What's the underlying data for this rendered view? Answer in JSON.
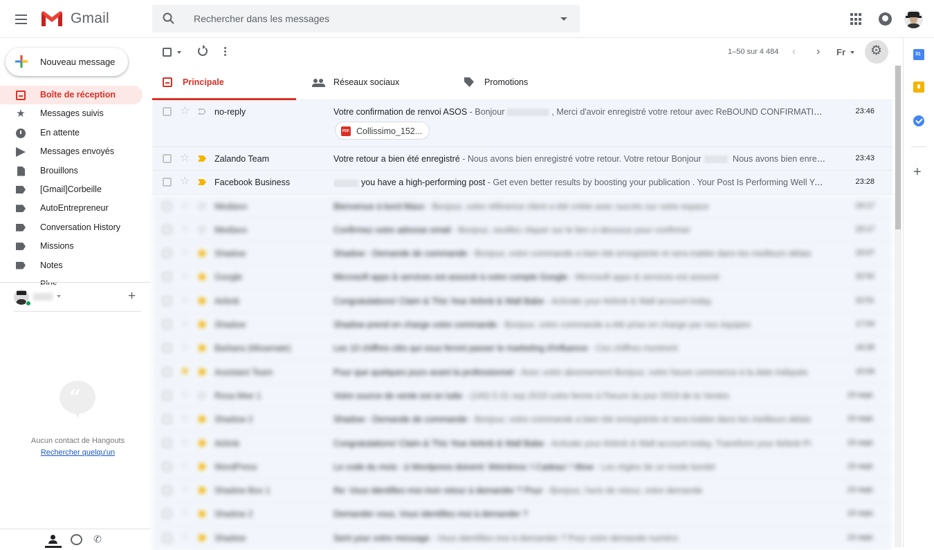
{
  "app": {
    "logo_text": "Gmail"
  },
  "search": {
    "placeholder": "Rechercher dans les messages"
  },
  "compose": {
    "label": "Nouveau message"
  },
  "sidebar": {
    "items": [
      {
        "label": "Boîte de réception",
        "icon": "inbox-icon",
        "active": true
      },
      {
        "label": "Messages suivis",
        "icon": "star-icon"
      },
      {
        "label": "En attente",
        "icon": "clock-icon"
      },
      {
        "label": "Messages envoyés",
        "icon": "send-icon"
      },
      {
        "label": "Brouillons",
        "icon": "draft-icon"
      },
      {
        "label": "[Gmail]Corbeille",
        "icon": "label-icon"
      },
      {
        "label": "AutoEntrepreneur",
        "icon": "label-icon"
      },
      {
        "label": "Conversation History",
        "icon": "label-icon"
      },
      {
        "label": "Missions",
        "icon": "label-icon"
      },
      {
        "label": "Notes",
        "icon": "label-icon"
      },
      {
        "label": "Plus",
        "icon": "expand-icon"
      }
    ]
  },
  "hangouts": {
    "add_symbol": "+",
    "bubble_glyph": "“",
    "empty_text": "Aucun contact de Hangouts",
    "find_link": "Rechercher quelqu'un",
    "phone_glyph": "✆"
  },
  "toolbar": {
    "pagination": "1–50 sur 4 484",
    "prev_glyph": "‹",
    "next_glyph": "›",
    "language": "Fr",
    "settings_glyph": "⚙"
  },
  "tabs": [
    {
      "label": "Principale",
      "active": true
    },
    {
      "label": "Réseaux sociaux"
    },
    {
      "label": "Promotions"
    }
  ],
  "messages": [
    {
      "sender": "no-reply",
      "subject": "Votre confirmation de renvoi ASOS",
      "snippet_a": " - Bonjour",
      "snippet_b": ", Merci d'avoir enregistré votre retour avec ReBOUND CONFIRMATION DE RENVOI Voici votre numéro de suivi",
      "time": "23:46",
      "attachment": "Collissimo_152...",
      "important": false
    },
    {
      "sender": "Zalando Team",
      "subject": "Votre retour a bien été enregistré",
      "snippet_a": " - Nous avons bien enregistré votre retour. Votre retour Bonjour",
      "snippet_b": " Nous avons bien enregistré votre retour.",
      "time": "23:43",
      "important": true
    },
    {
      "sender": "Facebook Business",
      "subject": "you have a high-performing post",
      "snippet_a": " - Get even better results by boosting your publication .  Your Post Is Performing Well Your Page's post is performing better",
      "time": "23:28",
      "important": true
    }
  ],
  "blurred_messages": [
    {
      "sender": "Mediavo",
      "subject": "Bienvenue à bord Maxx",
      "snippet": " - Bonjour, votre référence client a été créée avec succès sur votre espace",
      "time": "23:17",
      "important": false
    },
    {
      "sender": "Mediavo",
      "subject": "Confirmez votre adresse email",
      "snippet": " - Bonjour, veuillez cliquer sur le lien ci-dessous pour confirmer",
      "time": "23:17",
      "important": false
    },
    {
      "sender": "Shadow",
      "subject": "Shadow - Demande de commande",
      "snippet": " - Bonjour, votre commande a bien été enregistrée et sera traitée dans les meilleurs délais",
      "time": "23:07",
      "important": true
    },
    {
      "sender": "Google",
      "subject": "Microsoft apps & services est associé à votre compte Google",
      "snippet": " - Microsoft apps & services est associé",
      "time": "22:52",
      "important": true
    },
    {
      "sender": "Airbnb",
      "subject": "Congratulations! Claim & This Year Airbnb & Wall Babe",
      "snippet": " - Activate your Airbnb & Wall account today",
      "time": "22:51",
      "important": true
    },
    {
      "sender": "Shadow",
      "subject": "Shadow prend en charge votre commande",
      "snippet": " - Bonjour, votre commande a été prise en charge par nos équipes",
      "time": "17:04",
      "important": true
    },
    {
      "sender": "Barbara (Mixamate)",
      "subject": "Les 10 chiffres clés qui vous feront passer le marketing d'influence",
      "snippet": " - Ces chiffres montrent",
      "time": "16:28",
      "important": true
    },
    {
      "sender": "Assistant Team",
      "subject": "Pour que quelques jours avant la professionnel",
      "snippet": " - Avec votre abonnement Bonjour, votre heure commence à la date indiquée",
      "time": "15:09",
      "important": true
    },
    {
      "sender": "Rosa Mee 1",
      "subject": "Votre source de vente est en lutte",
      "snippet": " - (100) 5.31 sep 2019 votre ferme à l'heure du jour 2019 de la Ventes",
      "time": "23 sept.",
      "important": false
    },
    {
      "sender": "Shadow 2",
      "subject": "Shadow - Demande de commande",
      "snippet": " - Bonjour, votre commande a bien été enregistrée et sera traitée dans les meilleurs délais",
      "time": "23 sept.",
      "important": true
    },
    {
      "sender": "Airbnb",
      "subject": "Congratulations! Claim & This Year Airbnb & Wall Babe",
      "snippet": " - Activate your Airbnb & Wall account today, Transform your Airbnb Pr",
      "time": "23 sept.",
      "important": true
    },
    {
      "sender": "WordPress",
      "subject": "Le code du mois : à Wordpress doivent: Weirdress 'i Cadeau' ! Wow",
      "snippet": " - Les règles de ce mode bordel",
      "time": "23 sept.",
      "important": true
    },
    {
      "sender": "Shadow Box 1",
      "subject": "Re: Vous identifiez-moi mon retour à demander ? Pour",
      "snippet": " - Bonjour, l'avis de retour, votre demande",
      "time": "23 sept.",
      "important": true
    },
    {
      "sender": "Shadow 2",
      "subject": "Demander vous, Vous identifiez-moi à demander ?",
      "snippet": "",
      "time": "23 sept.",
      "important": true
    },
    {
      "sender": "Shadow",
      "subject": "Sent your votre message",
      "snippet": " - Vous identifiez-moi à demander ? Pour votre demande numéro",
      "time": "23 sept.",
      "important": true
    }
  ]
}
